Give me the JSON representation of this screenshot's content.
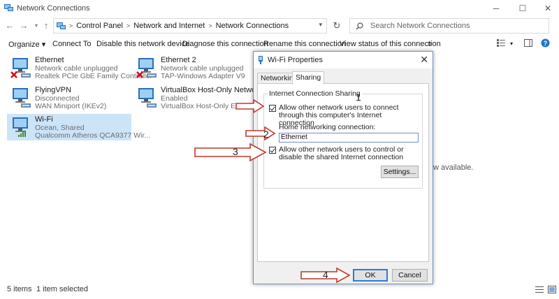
{
  "window": {
    "title": "Network Connections",
    "controls": {
      "minimize": "─",
      "maximize": "☐",
      "close": "✕"
    }
  },
  "address": {
    "crumbs": [
      "Control Panel",
      "Network and Internet",
      "Network Connections"
    ],
    "search_placeholder": "Search Network Connections"
  },
  "toolbar": {
    "organize": "Organize ▾",
    "connect_to": "Connect To",
    "disable": "Disable this network device",
    "diagnose": "Diagnose this connection",
    "rename": "Rename this connection",
    "view_status": "View status of this connection",
    "more": "»"
  },
  "items": [
    {
      "name": "Ethernet",
      "status": "Network cable unplugged",
      "device": "Realtek PCIe GbE Family Controller",
      "error": true
    },
    {
      "name": "Ethernet 2",
      "status": "Network cable unplugged",
      "device": "TAP-Windows Adapter V9",
      "error": true
    },
    {
      "name": "FlyingVPN",
      "status": "Disconnected",
      "device": "WAN Miniport (IKEv2)",
      "error": false
    },
    {
      "name": "VirtualBox Host-Only Network",
      "status": "Enabled",
      "device": "VirtualBox Host-Only Ethernet Ad...",
      "error": false
    },
    {
      "name": "Wi-Fi",
      "status": "Ocean, Shared",
      "device": "Qualcomm Atheros QCA9377 Wir...",
      "error": false,
      "selected": true
    }
  ],
  "side_text": "w available.",
  "status": {
    "count": "5 items",
    "selected": "1 item selected"
  },
  "dialog": {
    "title": "Wi-Fi Properties",
    "tabs": [
      "Networking",
      "Sharing"
    ],
    "group_label": "Internet Connection Sharing",
    "allow_connect": "Allow other network users to connect through this computer's Internet connection",
    "home_label": "Home networking connection:",
    "home_value": "Ethernet",
    "allow_control": "Allow other network users to control or disable the shared Internet connection",
    "settings": "Settings...",
    "ok": "OK",
    "cancel": "Cancel"
  },
  "annotations": [
    "1",
    "2",
    "3",
    "4"
  ],
  "colors": {
    "selection": "#cce4f7",
    "accent": "#2e7bd6",
    "arrow": "#c0392b"
  }
}
